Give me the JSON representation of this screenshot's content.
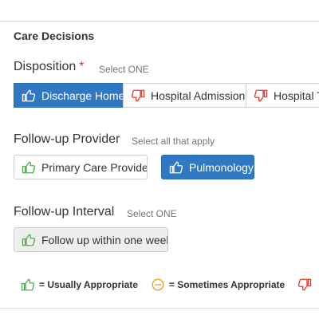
{
  "section_title": "Care Decisions",
  "disposition": {
    "label": "Disposition",
    "required_mark": "*",
    "hint": "Select ONE",
    "options": [
      {
        "label": "Discharge Home",
        "icon": "thumbs-up-icon",
        "selected": true
      },
      {
        "label": "Hospital Admission",
        "icon": "thumbs-down-icon",
        "selected": false
      },
      {
        "label": "Hospital T",
        "icon": "thumbs-down-icon",
        "selected": false
      }
    ]
  },
  "followup_provider": {
    "label": "Follow-up Provider",
    "hint": "Select all that apply",
    "options": [
      {
        "label": "Primary Care Provider",
        "icon": "thumbs-up-icon",
        "selected": false
      },
      {
        "label": "Pulmonology",
        "icon": "thumbs-up-icon",
        "selected": true
      }
    ]
  },
  "followup_interval": {
    "label": "Follow-up Interval",
    "hint": "Select ONE",
    "options": [
      {
        "label": "Follow up within one week",
        "icon": "thumbs-up-icon",
        "selected": false
      }
    ]
  },
  "legend": {
    "usually": "= Usually Appropriate",
    "sometimes": "= Sometimes Appropriate"
  },
  "colors": {
    "selected_blue": "#2f78c4",
    "usually_green": "#4caf50",
    "sometimes_orange": "#f39c12",
    "rarely_red": "#e53935"
  }
}
